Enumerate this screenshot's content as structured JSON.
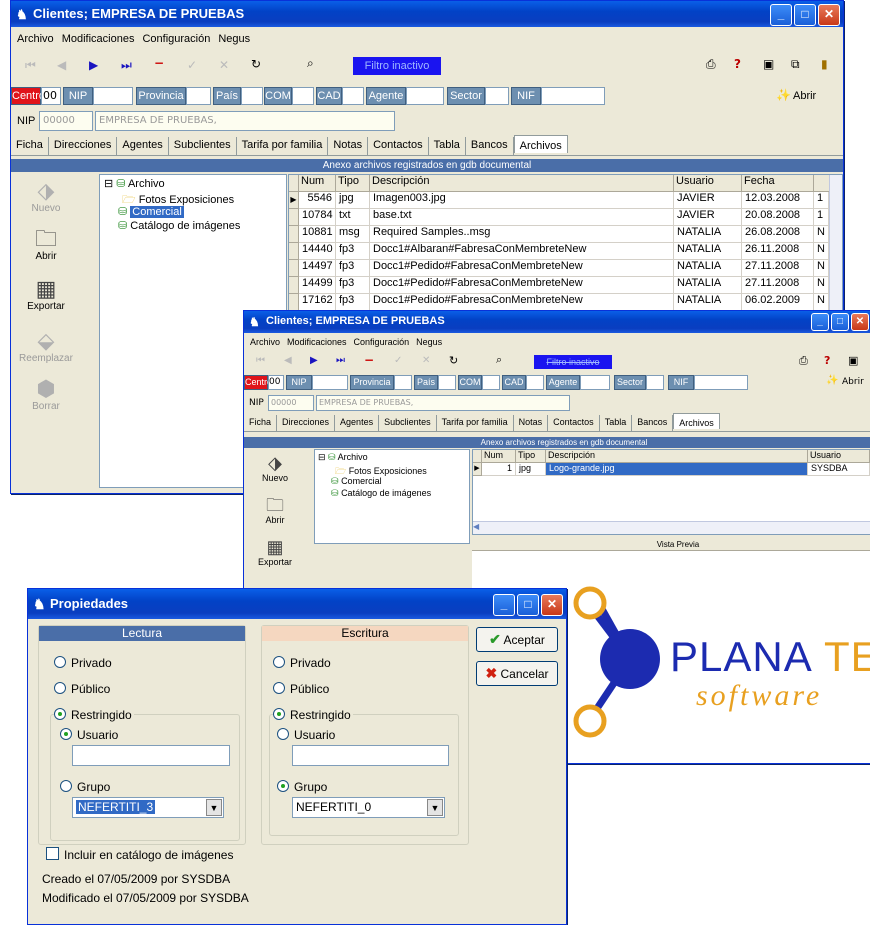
{
  "win1": {
    "title": "Clientes;   EMPRESA DE PRUEBAS",
    "menu": [
      "Archivo",
      "Modificaciones",
      "Configuración",
      "Negus"
    ],
    "filtro": "Filtro inactivo",
    "abrir": "Abrir",
    "filters": {
      "centro": "Centro",
      "centro_val": "00",
      "nip": "NIP",
      "provincia": "Provincia",
      "pais": "País",
      "com": "COM",
      "cad": "CAD",
      "agente": "Agente",
      "sector": "Sector",
      "nif": "NIF"
    },
    "nip_label": "NIP",
    "nip_code": "00000",
    "nip_name": "EMPRESA DE PRUEBAS,",
    "tabs": [
      "Ficha",
      "Direcciones",
      "Agentes",
      "Subclientes",
      "Tarifa por familia",
      "Notas",
      "Contactos",
      "Tabla",
      "Bancos",
      "Archivos"
    ],
    "header": "Anexo archivos registrados en gdb documental",
    "buttons": {
      "nuevo": "Nuevo",
      "abrir": "Abrir",
      "exportar": "Exportar",
      "reemplazar": "Reemplazar",
      "borrar": "Borrar"
    },
    "tree": {
      "root": "Archivo",
      "fotos": "Fotos Exposiciones",
      "comercial": "Comercial",
      "catalogo": "Catálogo de imágenes"
    },
    "cols": [
      "Num",
      "Tipo",
      "Descripción",
      "Usuario",
      "Fecha"
    ],
    "rows": [
      {
        "num": "5546",
        "tipo": "jpg",
        "desc": "Imagen003.jpg",
        "user": "JAVIER",
        "fecha": "12.03.2008",
        "x": "1"
      },
      {
        "num": "10784",
        "tipo": "txt",
        "desc": "base.txt",
        "user": "JAVIER",
        "fecha": "20.08.2008",
        "x": "1"
      },
      {
        "num": "10881",
        "tipo": "msg",
        "desc": "Required Samples..msg",
        "user": "NATALIA",
        "fecha": "26.08.2008",
        "x": "N"
      },
      {
        "num": "14440",
        "tipo": "fp3",
        "desc": "Docc1#Albaran#FabresaConMembreteNew",
        "user": "NATALIA",
        "fecha": "26.11.2008",
        "x": "N"
      },
      {
        "num": "14497",
        "tipo": "fp3",
        "desc": "Docc1#Pedido#FabresaConMembreteNew",
        "user": "NATALIA",
        "fecha": "27.11.2008",
        "x": "N"
      },
      {
        "num": "14499",
        "tipo": "fp3",
        "desc": "Docc1#Pedido#FabresaConMembreteNew",
        "user": "NATALIA",
        "fecha": "27.11.2008",
        "x": "N"
      },
      {
        "num": "17162",
        "tipo": "fp3",
        "desc": "Docc1#Pedido#FabresaConMembreteNew",
        "user": "NATALIA",
        "fecha": "06.02.2009",
        "x": "N"
      }
    ]
  },
  "win2": {
    "title": "Clientes;   EMPRESA DE PRUEBAS",
    "filtro": "Filtro inactivo",
    "abrir": "Abrir",
    "header": "Anexo archivos registrados en gdb documental",
    "cols": [
      "Num",
      "Tipo",
      "Descripción",
      "Usuario"
    ],
    "row": {
      "num": "1",
      "tipo": "jpg",
      "desc": "Logo-grande.jpg",
      "user": "SYSDBA"
    },
    "preview": "Vista Previa",
    "logo": {
      "plana": "PLANA",
      "tec": "TEC",
      "software": "software"
    }
  },
  "props": {
    "title": "Propiedades",
    "lectura": "Lectura",
    "escritura": "Escritura",
    "privado": "Privado",
    "publico": "Público",
    "restringido": "Restringido",
    "usuario": "Usuario",
    "grupo": "Grupo",
    "grupo_l": "NEFERTITI_3",
    "grupo_e": "NEFERTITI_0",
    "aceptar": "Aceptar",
    "cancelar": "Cancelar",
    "catalogo": "Incluir en catálogo de imágenes",
    "creado": "Creado el 07/05/2009 por SYSDBA",
    "modificado": "Modificado el 07/05/2009 por SYSDBA"
  },
  "colors": {
    "titlebar": "#0a3ec0",
    "filtro": "#1a14f0",
    "grid_header": "#4a6ea8",
    "selection": "#316ac5",
    "lectura_hdr": "#4a6ea8",
    "escritura_hdr": "#f5d7c0"
  }
}
